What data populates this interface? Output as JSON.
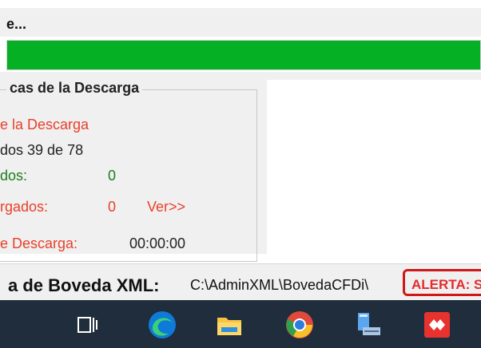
{
  "window": {
    "title": "e..."
  },
  "progress": {
    "value": 1.0,
    "color": "#06b025"
  },
  "stats_group": {
    "legend": "cas de la Descarga",
    "status": "e la Descarga",
    "counter": "dos 39 de 78",
    "downloaded_label": "dos:",
    "downloaded_value": "0",
    "not_downloaded_label": "rgados:",
    "not_downloaded_value": "0",
    "view_more": "Ver>>",
    "time_label": "e  Descarga:",
    "time_value": "00:00:00"
  },
  "boveda": {
    "label": "a de Boveda XML:",
    "path": "C:\\AdminXML\\BovedaCFDi\\",
    "alert": "ALERTA: S"
  },
  "taskbar": {
    "icons": [
      "task-view-icon",
      "edge-icon",
      "file-explorer-icon",
      "chrome-icon",
      "network-app-icon",
      "anydesk-icon"
    ]
  },
  "colors": {
    "red": "#e8402a",
    "green": "#1d7c1d",
    "alert": "#d01818"
  }
}
